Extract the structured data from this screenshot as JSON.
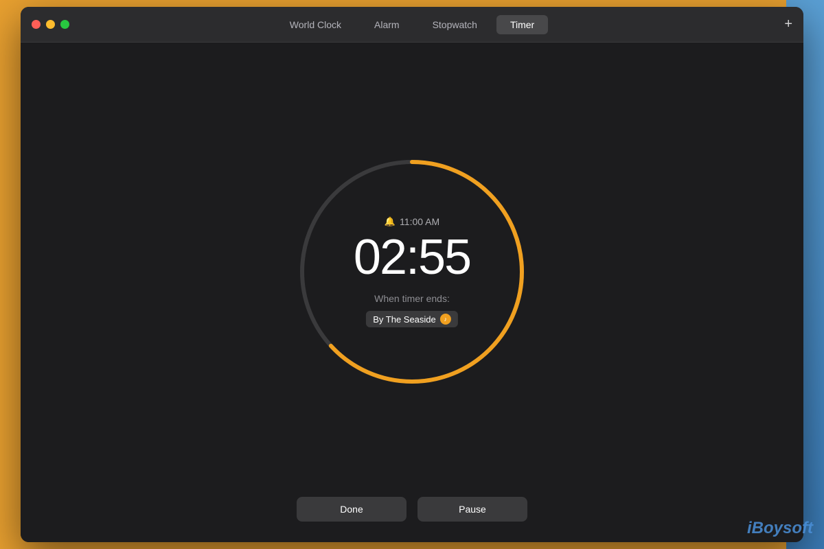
{
  "window": {
    "title": "Timer"
  },
  "tabs": [
    {
      "id": "world-clock",
      "label": "World Clock",
      "active": false
    },
    {
      "id": "alarm",
      "label": "Alarm",
      "active": false
    },
    {
      "id": "stopwatch",
      "label": "Stopwatch",
      "active": false
    },
    {
      "id": "timer",
      "label": "Timer",
      "active": true
    }
  ],
  "add_button_label": "+",
  "timer": {
    "alarm_time": "11:00 AM",
    "display": "02:55",
    "when_ends_label": "When timer ends:",
    "sound_name": "By The Seaside",
    "progress_percent": 60
  },
  "buttons": {
    "done": "Done",
    "pause": "Pause"
  },
  "watermark": "iBoysoft",
  "traffic_lights": {
    "close_label": "close",
    "minimize_label": "minimize",
    "maximize_label": "maximize"
  }
}
